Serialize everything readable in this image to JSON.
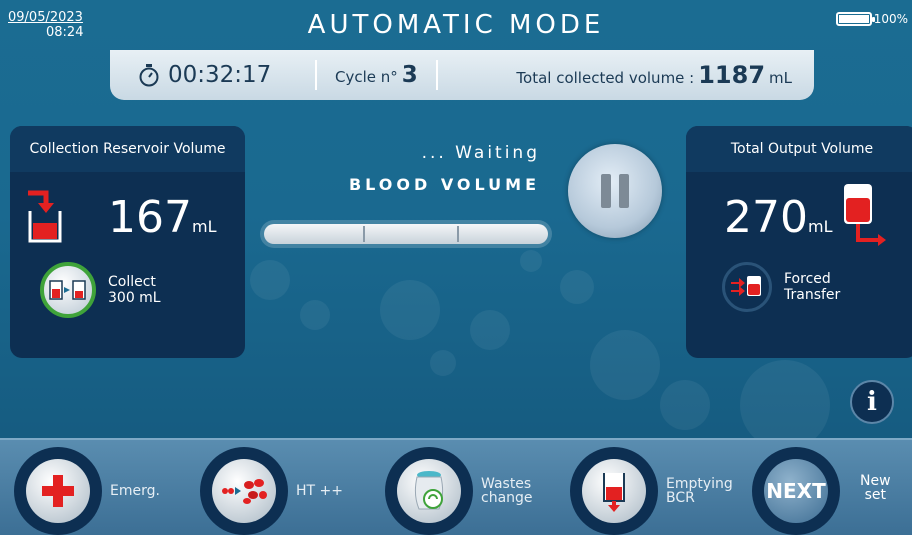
{
  "header": {
    "date": "09/05/2023",
    "time": "08:24",
    "title": "AUTOMATIC MODE",
    "battery": "100%"
  },
  "status": {
    "timer": "00:32:17",
    "cycle_label": "Cycle n°",
    "cycle_value": "3",
    "total_label": "Total collected volume :",
    "total_value": "1187",
    "total_unit": "mL"
  },
  "left_panel": {
    "title": "Collection Reservoir Volume",
    "volume": "167",
    "unit": "mL",
    "collect_line1": "Collect",
    "collect_line2": "300 mL"
  },
  "center": {
    "waiting": "... Waiting",
    "blood_volume": "BLOOD VOLUME"
  },
  "right_panel": {
    "title": "Total Output Volume",
    "volume": "270",
    "unit": "mL",
    "forced_line1": "Forced",
    "forced_line2": "Transfer"
  },
  "info_label": "i",
  "toolbar": {
    "emerg": "Emerg.",
    "ht": "HT ++",
    "wastes_line1": "Wastes",
    "wastes_line2": "change",
    "empty_line1": "Emptying",
    "empty_line2": "BCR",
    "next": "NEXT",
    "newset_line1": "New",
    "newset_line2": "set"
  },
  "colors": {
    "background": "#1b6c92",
    "panel": "#0d2f52",
    "blood": "#e32121",
    "collect_ring": "#3fa33a"
  }
}
